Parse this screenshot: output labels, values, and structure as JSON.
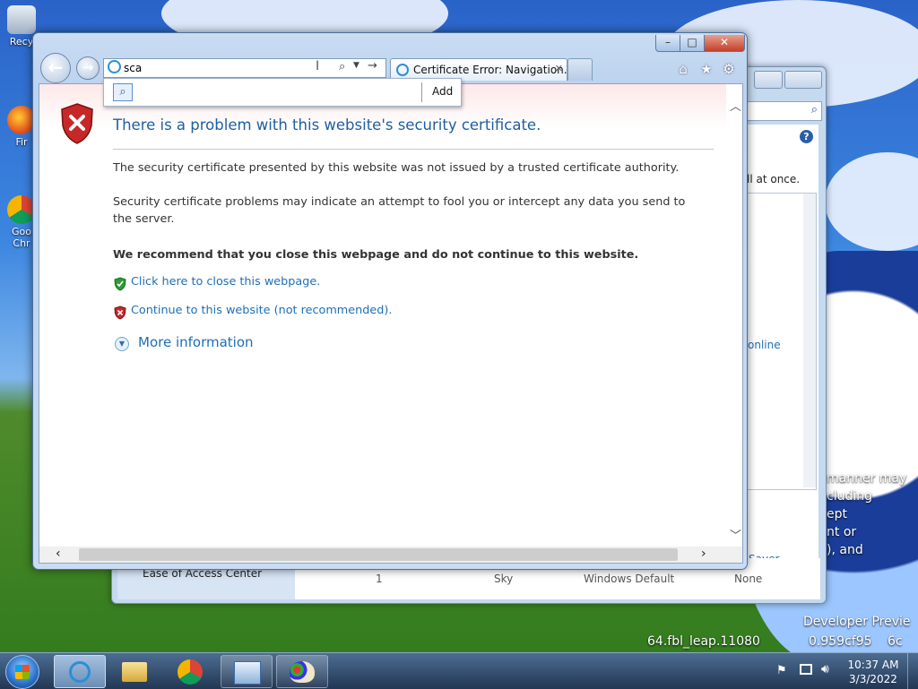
{
  "desktop": {
    "icons": [
      {
        "label": "Recy",
        "icon": "recycle-bin-icon"
      },
      {
        "label": "Fir",
        "icon": "firefox-icon"
      },
      {
        "label": "Goo Chr",
        "icon": "chrome-icon"
      }
    ],
    "wallpaper_text": [
      "manner may",
      "cluding",
      "ept",
      "nt or",
      "), and",
      "Developer Previe",
      "64.fbl_leap.11080",
      "0.959cf95",
      "6c"
    ]
  },
  "background_window": {
    "search_icon": "search-icon",
    "help_icon": "help-icon",
    "text_all_at_once": "ll at once.",
    "link_online": "online",
    "saver_label": "Saver",
    "footer": {
      "left_item": "Ease of Access Center",
      "col1": "1",
      "col2": "Sky",
      "col3": "Windows Default",
      "col4": "None"
    }
  },
  "ie": {
    "address_value": "sca",
    "tab_title": "Certificate Error: Navigation...",
    "dropdown": {
      "add_label": "Add"
    },
    "toolbar_icons": [
      "home-icon",
      "favorites-star-icon",
      "tools-gear-icon"
    ]
  },
  "cert_error": {
    "heading": "There is a problem with this website's security certificate.",
    "para1": "The security certificate presented by this website was not issued by a trusted certificate authority.",
    "para2": "Security certificate problems may indicate an attempt to fool you or intercept any data you send to the server.",
    "recommend": "We recommend that you close this webpage and do not continue to this website.",
    "close_link": "Click here to close this webpage.",
    "continue_link": "Continue to this website (not recommended).",
    "more_info": "More information"
  },
  "taskbar": {
    "time": "10:37 AM",
    "date": "3/3/2022",
    "items": [
      "ie-icon",
      "explorer-icon",
      "chrome-icon",
      "control-panel-icon",
      "paint-icon"
    ]
  },
  "colors": {
    "accent_blue": "#1f5fa0",
    "link_blue": "#1f6fb5",
    "shield_red": "#c62828",
    "shield_green": "#2e9a3a"
  }
}
